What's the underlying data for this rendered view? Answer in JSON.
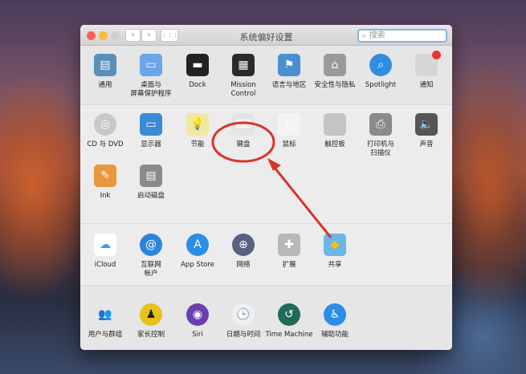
{
  "window": {
    "title": "系统偏好设置",
    "search_placeholder": "搜索",
    "back": "‹",
    "forward": "›",
    "grid": "⋮⋮⋮"
  },
  "sections": [
    {
      "rows": [
        [
          {
            "id": "general",
            "label": "通用",
            "icon": "general-icon",
            "color": "#5a8fb8",
            "glyph": "▤"
          },
          {
            "id": "desktop",
            "label": "桌面与\n屏幕保护程序",
            "icon": "desktop-icon",
            "color": "#6aa6e8",
            "glyph": "▭"
          },
          {
            "id": "dock",
            "label": "Dock",
            "icon": "dock-icon",
            "color": "#222222",
            "glyph": "▬"
          },
          {
            "id": "mission-control",
            "label": "Mission\nControl",
            "icon": "mission-control-icon",
            "color": "#2b2b2b",
            "glyph": "▦"
          },
          {
            "id": "language",
            "label": "语言与地区",
            "icon": "flag-icon",
            "color": "#4a90d0",
            "glyph": "⚑"
          },
          {
            "id": "security",
            "label": "安全性与隐私",
            "icon": "house-lock-icon",
            "color": "#9a9a9a",
            "glyph": "⌂"
          },
          {
            "id": "spotlight",
            "label": "Spotlight",
            "icon": "spotlight-icon",
            "color": "#2f8ee0",
            "glyph": "⌕",
            "round": true
          },
          {
            "id": "notifications",
            "label": "通知",
            "icon": "notifications-icon",
            "color": "#d6d6d6",
            "glyph": "●",
            "badge": true
          }
        ]
      ]
    },
    {
      "rows": [
        [
          {
            "id": "cd-dvd",
            "label": "CD 与 DVD",
            "icon": "disc-icon",
            "color": "#c8c8c8",
            "glyph": "◎",
            "round": true
          },
          {
            "id": "displays",
            "label": "显示器",
            "icon": "display-icon",
            "color": "#3a8ad8",
            "glyph": "▭"
          },
          {
            "id": "energy",
            "label": "节能",
            "icon": "lightbulb-icon",
            "color": "#f2e7a0",
            "glyph": "💡"
          },
          {
            "id": "keyboard",
            "label": "键盘",
            "icon": "keyboard-icon",
            "color": "#e4e4e4",
            "glyph": "⌨"
          },
          {
            "id": "mouse",
            "label": "鼠标",
            "icon": "mouse-icon",
            "color": "#f4f4f4",
            "glyph": "▯"
          },
          {
            "id": "trackpad",
            "label": "触控板",
            "icon": "trackpad-icon",
            "color": "#c4c4c4",
            "glyph": ""
          },
          {
            "id": "printers",
            "label": "打印机与\n扫描仪",
            "icon": "printer-icon",
            "color": "#8a8a8a",
            "glyph": "⎙"
          },
          {
            "id": "sound",
            "label": "声音",
            "icon": "speaker-icon",
            "color": "#555555",
            "glyph": "🔈"
          }
        ],
        [
          {
            "id": "ink",
            "label": "Ink",
            "icon": "ink-icon",
            "color": "#e8973a",
            "glyph": "✎"
          },
          {
            "id": "startup-disk",
            "label": "启动磁盘",
            "icon": "disk-icon",
            "color": "#8a8a8a",
            "glyph": "▤"
          }
        ]
      ]
    },
    {
      "rows": [
        [
          {
            "id": "icloud",
            "label": "iCloud",
            "icon": "cloud-icon",
            "color": "#ffffff",
            "glyph": "☁",
            "fg": "#3b9ce8"
          },
          {
            "id": "internet-accounts",
            "label": "互联网\n帐户",
            "icon": "at-icon",
            "color": "#2a86dc",
            "glyph": "@",
            "round": true
          },
          {
            "id": "app-store",
            "label": "App Store",
            "icon": "app-store-icon",
            "color": "#2b8ee6",
            "glyph": "A",
            "round": true
          },
          {
            "id": "network",
            "label": "网络",
            "icon": "globe-icon",
            "color": "#5a6080",
            "glyph": "⊕",
            "round": true
          },
          {
            "id": "extensions",
            "label": "扩展",
            "icon": "puzzle-icon",
            "color": "#b8b8b8",
            "glyph": "✚"
          },
          {
            "id": "sharing",
            "label": "共享",
            "icon": "shared-folder-icon",
            "color": "#6cb6e8",
            "glyph": "◆",
            "fg": "#f2c400"
          }
        ]
      ]
    },
    {
      "rows": [
        [
          {
            "id": "users-groups",
            "label": "用户与群组",
            "icon": "users-icon",
            "color": "transparent",
            "glyph": "👥",
            "fg": "#222"
          },
          {
            "id": "parental-controls",
            "label": "家长控制",
            "icon": "parental-controls-icon",
            "color": "#e6c21a",
            "glyph": "♟",
            "round": true,
            "fg": "#222"
          },
          {
            "id": "siri",
            "label": "Siri",
            "icon": "siri-icon",
            "color": "#6a3fb0",
            "glyph": "◉",
            "round": true
          },
          {
            "id": "date-time",
            "label": "日期与时间",
            "icon": "clock-icon",
            "color": "#f0f0f0",
            "glyph": "🕒",
            "round": true,
            "fg": "#333"
          },
          {
            "id": "time-machine",
            "label": "Time Machine",
            "icon": "time-machine-icon",
            "color": "#1f6a5a",
            "glyph": "↺",
            "round": true
          },
          {
            "id": "accessibility",
            "label": "辅助功能",
            "icon": "accessibility-icon",
            "color": "#2b8ee6",
            "glyph": "♿",
            "round": true
          }
        ]
      ]
    }
  ],
  "annotation": {
    "color": "#d9332b"
  }
}
